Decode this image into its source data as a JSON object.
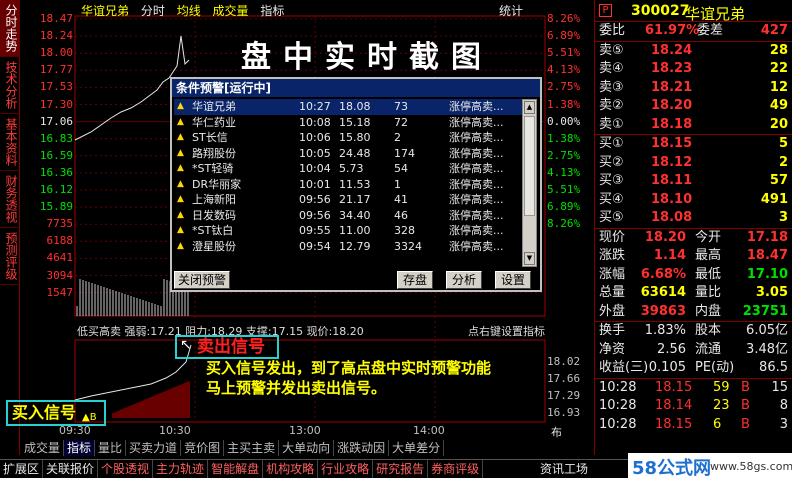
{
  "left_tabs": [
    "分时走势",
    "技术分析",
    "基本资料",
    "财务透视",
    "预测评级"
  ],
  "chart_header": {
    "name": "华谊兄弟",
    "items": [
      "分时",
      "均线",
      "成交量",
      "指标"
    ],
    "stat": "统计"
  },
  "title_banner": "盘中实时截图",
  "price_axis_left": [
    "18.47",
    "18.24",
    "18.00",
    "17.77",
    "17.53",
    "17.30",
    "17.06",
    "16.83",
    "16.59",
    "16.36",
    "16.12",
    "15.89",
    "7735",
    "6188",
    "4641",
    "3094",
    "1547"
  ],
  "price_axis_right": [
    "8.26%",
    "6.89%",
    "5.51%",
    "4.13%",
    "2.75%",
    "1.38%",
    "0.00%",
    "1.38%",
    "2.75%",
    "4.13%",
    "5.51%",
    "6.89%",
    "8.26%"
  ],
  "indicator_axis_right": [
    "18.02",
    "17.66",
    "17.29",
    "16.93"
  ],
  "sub_header": {
    "text": "低买高卖 强弱:17.21 阻力:18.29 支撑:17.15 现价:18.20",
    "right": "点右键设置指标"
  },
  "time_axis": [
    "09:30",
    "10:30",
    "13:00",
    "14:00",
    "布局"
  ],
  "dialog": {
    "title": "条件预警[运行中]",
    "rows": [
      {
        "name": "华谊兄弟",
        "time": "10:27",
        "price": "18.08",
        "vol": "73",
        "cond": "涨停高卖..."
      },
      {
        "name": "华仁药业",
        "time": "10:08",
        "price": "15.18",
        "vol": "72",
        "cond": "涨停高卖..."
      },
      {
        "name": "ST长信",
        "time": "10:06",
        "price": "15.80",
        "vol": "2",
        "cond": "涨停高卖..."
      },
      {
        "name": "路翔股份",
        "time": "10:05",
        "price": "24.48",
        "vol": "174",
        "cond": "涨停高卖..."
      },
      {
        "name": "*ST轻骑",
        "time": "10:04",
        "price": "5.73",
        "vol": "54",
        "cond": "涨停高卖..."
      },
      {
        "name": "DR华丽家",
        "time": "10:01",
        "price": "11.53",
        "vol": "1",
        "cond": "涨停高卖..."
      },
      {
        "name": "上海新阳",
        "time": "09:56",
        "price": "21.17",
        "vol": "41",
        "cond": "涨停高卖..."
      },
      {
        "name": "日发数码",
        "time": "09:56",
        "price": "34.40",
        "vol": "46",
        "cond": "涨停高卖..."
      },
      {
        "name": "*ST钛白",
        "time": "09:55",
        "price": "11.00",
        "vol": "328",
        "cond": "涨停高卖..."
      },
      {
        "name": "澄星股份",
        "time": "09:54",
        "price": "12.79",
        "vol": "3324",
        "cond": "涨停高卖..."
      }
    ],
    "close_btn": "关闭预警",
    "save_btn": "存盘",
    "analyze_btn": "分析",
    "settings_btn": "设置"
  },
  "annotations": {
    "sell_signal": "卖出信号",
    "buy_signal": "买入信号",
    "desc_line1": "买入信号发出，到了高点盘中实时预警功能",
    "desc_line2": "马上预警并发出卖出信号。",
    "buy_marker": "▲B"
  },
  "right_panel": {
    "code": "300027",
    "name": "华谊兄弟",
    "logo": "P",
    "weibi": {
      "label1": "委比",
      "val1": "61.97%",
      "label2": "委差",
      "val2": "427"
    },
    "asks": [
      {
        "label": "卖⑤",
        "price": "18.24",
        "vol": "28"
      },
      {
        "label": "卖④",
        "price": "18.23",
        "vol": "22"
      },
      {
        "label": "卖③",
        "price": "18.21",
        "vol": "12"
      },
      {
        "label": "卖②",
        "price": "18.20",
        "vol": "49"
      },
      {
        "label": "卖①",
        "price": "18.18",
        "vol": "20"
      }
    ],
    "bids": [
      {
        "label": "买①",
        "price": "18.15",
        "vol": "5"
      },
      {
        "label": "买②",
        "price": "18.12",
        "vol": "2"
      },
      {
        "label": "买③",
        "price": "18.11",
        "vol": "57"
      },
      {
        "label": "买④",
        "price": "18.10",
        "vol": "491"
      },
      {
        "label": "买⑤",
        "price": "18.08",
        "vol": "3"
      }
    ],
    "stats": [
      {
        "l1": "现价",
        "v1": "18.20",
        "l2": "今开",
        "v2": "17.18"
      },
      {
        "l1": "涨跌",
        "v1": "1.14",
        "l2": "最高",
        "v2": "18.47"
      },
      {
        "l1": "涨幅",
        "v1": "6.68%",
        "l2": "最低",
        "v2": "17.10"
      },
      {
        "l1": "总量",
        "v1": "63614",
        "l2": "量比",
        "v2": "3.05"
      },
      {
        "l1": "外盘",
        "v1": "39863",
        "l2": "内盘",
        "v2": "23751"
      }
    ],
    "stats2": [
      {
        "l1": "换手",
        "v1": "1.83%",
        "l2": "股本",
        "v2": "6.05亿"
      },
      {
        "l1": "净资",
        "v1": "2.56",
        "l2": "流通",
        "v2": "3.48亿"
      },
      {
        "l1": "收益(三)",
        "v1": "0.105",
        "l2": "PE(动)",
        "v2": "86.5"
      }
    ],
    "ticks": [
      {
        "time": "10:28",
        "price": "18.15",
        "vol": "59",
        "side": "B",
        "n": "15"
      },
      {
        "time": "10:28",
        "price": "18.14",
        "vol": "23",
        "side": "B",
        "n": "8"
      },
      {
        "time": "10:28",
        "price": "18.15",
        "vol": "6",
        "side": "B",
        "n": "3"
      }
    ]
  },
  "bottom_tabs1": [
    "成交量",
    "指标",
    "量比",
    "买卖力道",
    "竞价图",
    "主买主卖",
    "大单动向",
    "涨跌动因",
    "大单差分"
  ],
  "bottom_tabs2": [
    "扩展区",
    "关联报价",
    "个股透视",
    "主力轨迹",
    "智能解盘",
    "机构攻略",
    "行业攻略",
    "研究报告",
    "券商评级"
  ],
  "bottom_tabs2_right": "资讯工场",
  "watermark": {
    "brand": "58公式网",
    "url": "www.58gs.com"
  }
}
